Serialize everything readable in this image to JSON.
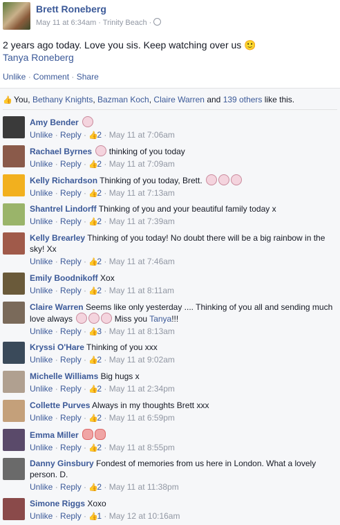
{
  "post": {
    "author": "Brett Roneberg",
    "meta": "May 11 at 6:34am · Trinity Beach ·",
    "text": "2 years ago today. Love you sis. Keep watching over us 🙂",
    "tag": "Tanya Roneberg",
    "actions": {
      "unlike": "Unlike",
      "comment": "Comment",
      "share": "Share"
    }
  },
  "likes": {
    "you": "You,",
    "names": [
      "Bethany Knights",
      "Bazman Koch",
      "Claire Warren"
    ],
    "and": "and",
    "others": "139 others",
    "suffix": "like this."
  },
  "comments": [
    {
      "name": "Amy Bender",
      "text": "",
      "hearts": 1,
      "likes": "2",
      "time": "May 11 at 7:06am",
      "avatar": "#3a3a3a"
    },
    {
      "name": "Rachael Byrnes",
      "text": "thinking of you today",
      "hearts_before": 1,
      "likes": "2",
      "time": "May 11 at 7:09am",
      "avatar": "#8a5a4a"
    },
    {
      "name": "Kelly Richardson",
      "text": "Thinking of you today, Brett.",
      "hearts": 3,
      "likes": "2",
      "time": "May 11 at 7:13am",
      "avatar": "#f2b01e"
    },
    {
      "name": "Shantrel Lindorff",
      "text": "Thinking of you and your beautiful family today x",
      "likes": "2",
      "time": "May 11 at 7:39am",
      "avatar": "#9ab46a"
    },
    {
      "name": "Kelly Brearley",
      "text": "Thinking of you today! No doubt there will be a big rainbow in the sky! Xx",
      "likes": "2",
      "time": "May 11 at 7:46am",
      "avatar": "#a05a4a"
    },
    {
      "name": "Emily Boodnikoff",
      "text": "Xox",
      "likes": "2",
      "time": "May 11 at 8:11am",
      "avatar": "#6a5a3a"
    },
    {
      "name": "Claire Warren",
      "text": "Seems like only yesterday .... Thinking of you all and sending much love always",
      "hearts": 3,
      "text_after": "Miss you",
      "tag": "Tanya",
      "tag_after": "!!!",
      "likes": "3",
      "time": "May 11 at 8:13am",
      "avatar": "#7a6a5a"
    },
    {
      "name": "Kryssi O'Hare",
      "text": "Thinking of you xxx",
      "likes": "2",
      "time": "May 11 at 9:02am",
      "avatar": "#3a4a5a"
    },
    {
      "name": "Michelle Williams",
      "text": "Big hugs x",
      "likes": "2",
      "time": "May 11 at 2:34pm",
      "avatar": "#b0a090"
    },
    {
      "name": "Collette Purves",
      "text": "Always in my thoughts Brett xxx",
      "likes": "2",
      "time": "May 11 at 6:59pm",
      "avatar": "#c4a07a"
    },
    {
      "name": "Emma Miller",
      "text": "",
      "bowhearts": 2,
      "likes": "2",
      "time": "May 11 at 8:55pm",
      "avatar": "#5a4a6a"
    },
    {
      "name": "Danny Ginsbury",
      "text": "Fondest of memories from us here in London. What a lovely person. D.",
      "likes": "2",
      "time": "May 11 at 11:38pm",
      "avatar": "#6a6a6a"
    },
    {
      "name": "Simone Riggs",
      "text": "Xoxo",
      "likes": "1",
      "time": "May 12 at 10:16am",
      "avatar": "#8a4a4a"
    }
  ],
  "labels": {
    "unlike": "Unlike",
    "reply": "Reply"
  },
  "colors": {
    "link": "#3b5998",
    "meta": "#9197a3",
    "bg": "#f6f7f9"
  }
}
